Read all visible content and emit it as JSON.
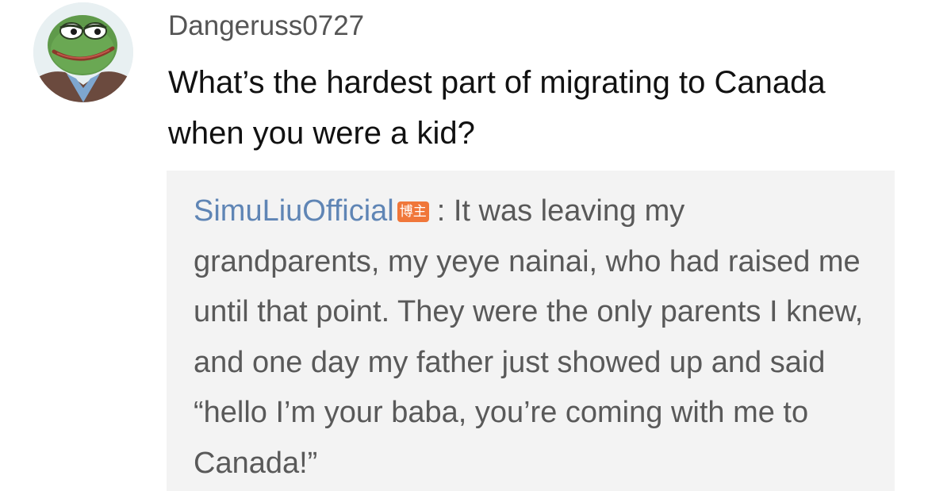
{
  "comment": {
    "username": "Dangeruss0727",
    "text": "What’s the hardest part of migrating to Canada when you were a kid?"
  },
  "reply": {
    "author": "SimuLiuOfficial",
    "badge": "博主",
    "separator": ":",
    "text": "It was leaving my grandparents, my yeye nainai, who had raised me until that point. They were the only parents I knew, and one day my father just showed up and said “hello I’m your baba, you’re coming with me to Canada!”"
  },
  "colors": {
    "author_link": "#5f85b5",
    "badge": "#f0773a",
    "reply_background": "#f3f3f3"
  }
}
